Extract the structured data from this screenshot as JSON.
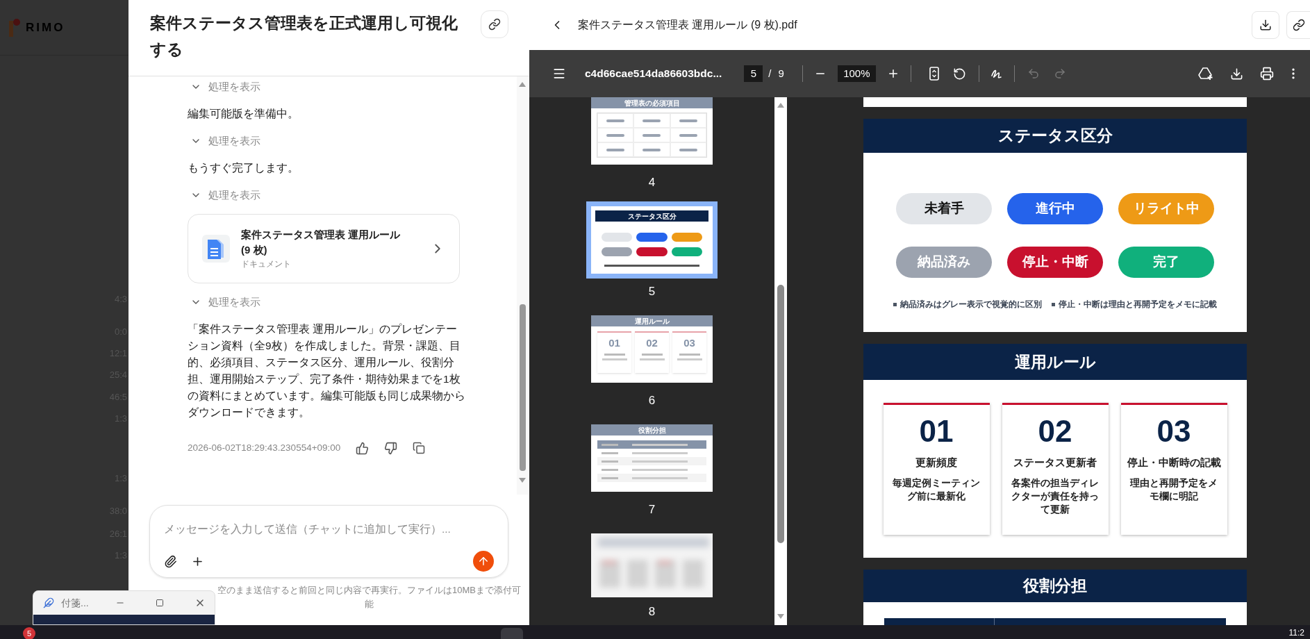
{
  "background_app": {
    "logo": "RIMO",
    "times": [
      "4:3",
      "0:0",
      "12:1",
      "25:4",
      "46:5",
      "1:3",
      "1:3",
      "38:0",
      "26:1",
      "1:3"
    ]
  },
  "chat": {
    "title": "案件ステータス管理表を正式運用し可視化する",
    "messages": [
      {
        "kind": "toggle",
        "label": "処理を表示",
        "expanded": false
      },
      {
        "kind": "text",
        "text": "編集可能版を準備中。"
      },
      {
        "kind": "toggle",
        "label": "処理を表示",
        "expanded": false
      },
      {
        "kind": "text",
        "text": "もうすぐ完了します。"
      },
      {
        "kind": "toggle",
        "label": "処理を表示",
        "expanded": false
      },
      {
        "kind": "file",
        "title": "案件ステータス管理表 運用ルール (9 枚)",
        "subtitle": "ドキュメント"
      },
      {
        "kind": "toggle",
        "label": "処理を表示",
        "expanded": false
      },
      {
        "kind": "text",
        "text": "「案件ステータス管理表 運用ルール」のプレゼンテーション資料（全9枚）を作成しました。背景・課題、目的、必須項目、ステータス区分、運用ルール、役割分担、運用開始ステップ、完了条件・期待効果までを1枚の資料にまとめています。編集可能版も同じ成果物からダウンロードできます。"
      }
    ],
    "timestamp": "2026-06-02T18:29:43.230554+09:00",
    "input": {
      "placeholder": "メッセージを入力して送信（チャットに追加して実行）..."
    },
    "hint": "空のまま送信すると前回と同じ内容で再実行。ファイルは10MBまで添付可能"
  },
  "pdf": {
    "file_title": "案件ステータス管理表 運用ルール (9 枚).pdf",
    "toolbar": {
      "file_name": "c4d66cae514da86603bdc...",
      "page": "5",
      "page_separator": "/",
      "page_count": "9",
      "zoom": "100%",
      "undo_disabled": true,
      "redo_disabled": true
    },
    "thumbnails": [
      {
        "kind": "grid",
        "page": "4",
        "title": "管理表の必須項目",
        "selected": false
      },
      {
        "kind": "pills",
        "page": "5",
        "title": "ステータス区分",
        "selected": true
      },
      {
        "kind": "cards",
        "page": "6",
        "title": "運用ルール",
        "numbers": [
          "01",
          "02",
          "03"
        ],
        "selected": false
      },
      {
        "kind": "table",
        "page": "7",
        "title": "役割分担",
        "selected": false
      },
      {
        "kind": "blurred",
        "page": "8",
        "selected": false
      }
    ],
    "slides": [
      {
        "kind": "partial"
      },
      {
        "kind": "status",
        "title": "ステータス区分",
        "statuses": [
          {
            "label": "未着手",
            "color": "#e2e5e9"
          },
          {
            "label": "進行中",
            "color": "#2563eb"
          },
          {
            "label": "リライト中",
            "color": "#ee9a16"
          },
          {
            "label": "納品済み",
            "color": "#9ca3af"
          },
          {
            "label": "停止・中断",
            "color": "#c8102e"
          },
          {
            "label": "完了",
            "color": "#10b07c"
          }
        ],
        "notes": [
          "納品済みはグレー表示で視覚的に区別",
          "停止・中断は理由と再開予定をメモに記載"
        ]
      },
      {
        "kind": "rules",
        "title": "運用ルール",
        "rules": [
          {
            "number": "01",
            "heading": "更新頻度",
            "body": "毎週定例ミーティング前に最新化"
          },
          {
            "number": "02",
            "heading": "ステータス更新者",
            "body": "各案件の担当ディレクターが責任を持って更新"
          },
          {
            "number": "03",
            "heading": "停止・中断時の記載",
            "body": "理由と再開予定をメモ欄に明記"
          }
        ]
      },
      {
        "kind": "roles",
        "title": "役割分担"
      }
    ]
  },
  "sticky_note": {
    "title": "付箋..."
  },
  "taskbar": {
    "badge": "5",
    "clock": "11:2"
  }
}
